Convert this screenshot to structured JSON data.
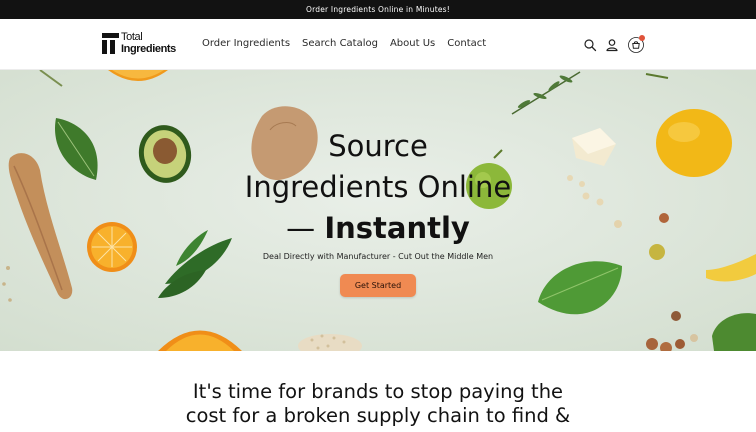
{
  "announcement": "Order Ingredients Online in Minutes!",
  "logo": {
    "line1": "Total",
    "line2": "Ingredients"
  },
  "nav": {
    "items": [
      {
        "label": "Order Ingredients"
      },
      {
        "label": "Search Catalog"
      },
      {
        "label": "About Us"
      },
      {
        "label": "Contact"
      }
    ]
  },
  "header_icons": [
    "search-icon",
    "account-icon",
    "cart-icon"
  ],
  "hero": {
    "title_line1": "Source",
    "title_line2": "Ingredients Online",
    "title_line3_prefix": "— ",
    "title_line3_bold": "Instantly",
    "subtitle": "Deal Directly with Manufacturer - Cut Out the Middle Men",
    "cta_label": "Get Started"
  },
  "mission": {
    "line1": "It's time for brands to stop paying the",
    "line2": "cost for a broken supply chain to find &"
  },
  "colors": {
    "announcement_bg": "#121212",
    "hero_bg": "#dfe8e0",
    "cta_bg": "#f08a52",
    "cart_badge": "#e0533a"
  }
}
